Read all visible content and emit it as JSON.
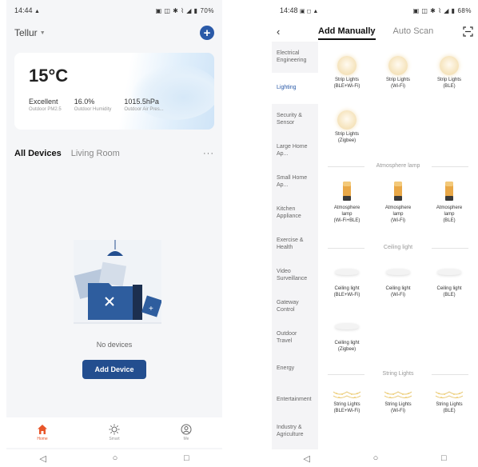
{
  "left": {
    "status": {
      "time": "14:44",
      "notif": "▲",
      "icons": "▣ ◫ ✱ ⌇ ◢ ▮",
      "battery": "70%"
    },
    "header": {
      "home_name": "Tellur",
      "caret": "▼",
      "add_icon": "plus-circle-icon"
    },
    "weather": {
      "temperature": "15°C",
      "stats": [
        {
          "value": "Excellent",
          "label": "Outdoor PM2.5"
        },
        {
          "value": "16.0%",
          "label": "Outdoor Humidity"
        },
        {
          "value": "1015.5hPa",
          "label": "Outdoor Air Pres..."
        }
      ]
    },
    "rooms": {
      "tabs": [
        "All Devices",
        "Living Room"
      ],
      "more": "···"
    },
    "empty": {
      "message": "No devices",
      "button": "Add Device"
    },
    "nav": [
      {
        "label": "Home",
        "icon": "home-icon",
        "active": true
      },
      {
        "label": "Smart",
        "icon": "sun-icon",
        "active": false
      },
      {
        "label": "Me",
        "icon": "user-icon",
        "active": false
      }
    ],
    "system": {
      "back": "◁",
      "home": "○",
      "recent": "□"
    }
  },
  "right": {
    "status": {
      "time": "14:48",
      "notif": "▣ ◻ ▲",
      "icons": "▣ ◫ ✱ ⌇ ◢ ▮",
      "battery": "68%"
    },
    "header": {
      "back": "‹",
      "tab_manual": "Add Manually",
      "tab_auto": "Auto Scan",
      "scan_icon": "scan-icon"
    },
    "categories": [
      "Electrical Engineering",
      "Lighting",
      "Security & Sensor",
      "Large Home Ap...",
      "Small Home Ap...",
      "Kitchen Appliance",
      "Exercise & Health",
      "Video Surveillance",
      "Gateway Control",
      "Outdoor Travel",
      "Energy",
      "Entertainment",
      "Industry & Agriculture"
    ],
    "active_category": 1,
    "sections": {
      "strip": [
        "Strip Lights\n(BLE+Wi-Fi)",
        "Strip Lights\n(Wi-Fi)",
        "Strip Lights\n(BLE)",
        "Strip Lights\n(Zigbee)"
      ],
      "atmo_title": "Atmosphere lamp",
      "atmo": [
        "Atmosphere\nlamp\n(Wi-Fi+BLE)",
        "Atmosphere\nlamp\n(Wi-Fi)",
        "Atmosphere\nlamp\n(BLE)"
      ],
      "ceiling_title": "Ceiling light",
      "ceiling": [
        "Ceiling light\n(BLE+Wi-Fi)",
        "Ceiling light\n(Wi-Fi)",
        "Ceiling light\n(BLE)",
        "Ceiling light\n(Zigbee)"
      ],
      "string_title": "String Lights",
      "string": [
        "String Lights\n(BLE+Wi-Fi)",
        "String Lights\n(Wi-Fi)",
        "String Lights\n(BLE)"
      ]
    },
    "system": {
      "back": "◁",
      "home": "○",
      "recent": "□"
    }
  },
  "colors": {
    "accent": "#2a5aa8",
    "button": "#234e8f",
    "nav_active": "#e8562a"
  }
}
